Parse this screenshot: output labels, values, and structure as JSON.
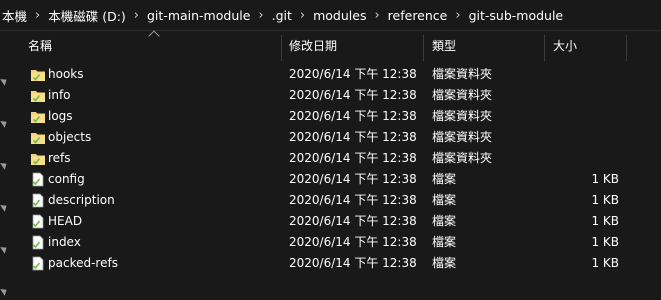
{
  "breadcrumb": [
    "本機",
    "本機磁碟 (D:)",
    "git-main-module",
    ".git",
    "modules",
    "reference",
    "git-sub-module"
  ],
  "columns": {
    "name": "名稱",
    "date": "修改日期",
    "type": "類型",
    "size": "大小"
  },
  "files": [
    {
      "name": "hooks",
      "date": "2020/6/14 下午 12:38",
      "type": "檔案資料夾",
      "size": "",
      "icon": "folder-icon"
    },
    {
      "name": "info",
      "date": "2020/6/14 下午 12:38",
      "type": "檔案資料夾",
      "size": "",
      "icon": "folder-icon"
    },
    {
      "name": "logs",
      "date": "2020/6/14 下午 12:38",
      "type": "檔案資料夾",
      "size": "",
      "icon": "folder-icon"
    },
    {
      "name": "objects",
      "date": "2020/6/14 下午 12:38",
      "type": "檔案資料夾",
      "size": "",
      "icon": "folder-icon"
    },
    {
      "name": "refs",
      "date": "2020/6/14 下午 12:38",
      "type": "檔案資料夾",
      "size": "",
      "icon": "folder-icon"
    },
    {
      "name": "config",
      "date": "2020/6/14 下午 12:38",
      "type": "檔案",
      "size": "1 KB",
      "icon": "file-icon"
    },
    {
      "name": "description",
      "date": "2020/6/14 下午 12:38",
      "type": "檔案",
      "size": "1 KB",
      "icon": "file-icon"
    },
    {
      "name": "HEAD",
      "date": "2020/6/14 下午 12:38",
      "type": "檔案",
      "size": "1 KB",
      "icon": "file-icon"
    },
    {
      "name": "index",
      "date": "2020/6/14 下午 12:38",
      "type": "檔案",
      "size": "1 KB",
      "icon": "file-icon"
    },
    {
      "name": "packed-refs",
      "date": "2020/6/14 下午 12:38",
      "type": "檔案",
      "size": "1 KB",
      "icon": "file-icon"
    }
  ],
  "colors": {
    "background": "#191919",
    "text": "#ffffff",
    "check": "#74c043"
  }
}
